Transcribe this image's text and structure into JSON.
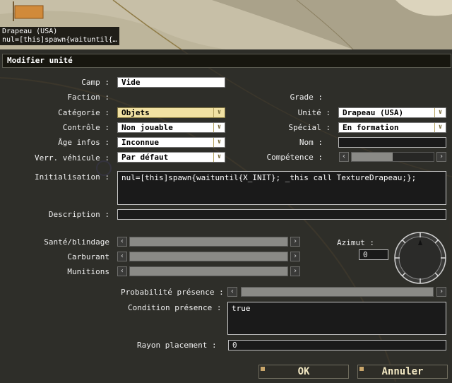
{
  "map": {
    "marker_line1": "Drapeau (USA)",
    "marker_line2": "nul=[this]spawn{waituntil{…"
  },
  "dialog": {
    "title": "Modifier unité",
    "labels": {
      "camp": "Camp :",
      "faction": "Faction :",
      "categorie": "Catégorie :",
      "controle": "Contrôle :",
      "age_infos": "Âge infos :",
      "verr_vehicule": "Verr. véhicule :",
      "grade": "Grade :",
      "unite": "Unité :",
      "special": "Spécial :",
      "nom": "Nom :",
      "competence": "Compétence :",
      "initialisation": "Initialisation :",
      "description": "Description :",
      "sante": "Santé/blindage",
      "carburant": "Carburant",
      "munitions": "Munitions",
      "azimut": "Azimut :",
      "probabilite": "Probabilité présence :",
      "condition": "Condition présence :",
      "rayon": "Rayon placement :"
    },
    "values": {
      "camp": "Vide",
      "categorie": "Objets",
      "controle": "Non jouable",
      "age_infos": "Inconnue",
      "verr_vehicule": "Par défaut",
      "unite": "Drapeau (USA)",
      "special": "En formation",
      "nom": "",
      "initialisation": "nul=[this]spawn{waituntil{X_INIT}; _this call TextureDrapeau;};",
      "description": "",
      "azimut": "0",
      "condition": "true",
      "rayon": "0"
    },
    "sliders": {
      "competence": 0.5,
      "sante": 1.0,
      "carburant": 1.0,
      "munitions": 1.0,
      "probabilite": 1.0
    },
    "icons": {
      "dropdown": "chevron-down-icon",
      "left": "arrow-left-icon",
      "right": "arrow-right-icon"
    },
    "buttons": {
      "ok": "OK",
      "cancel": "Annuler"
    }
  }
}
